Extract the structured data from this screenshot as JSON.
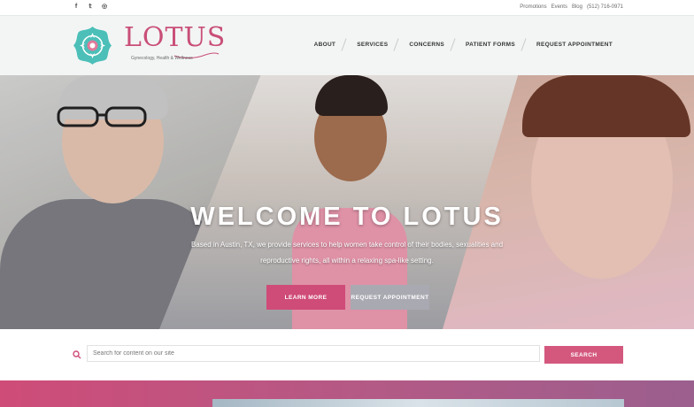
{
  "topbar": {
    "social": [
      {
        "name": "facebook-icon",
        "glyph": "f"
      },
      {
        "name": "twitter-icon",
        "glyph": "𝕥"
      },
      {
        "name": "instagram-icon",
        "glyph": "◎"
      }
    ],
    "links": [
      "Promotions",
      "Events",
      "Blog",
      "(512) 716-0971"
    ]
  },
  "brand": {
    "name": "LOTUS",
    "tagline": "Gynecology, Health & Wellness",
    "logo_color": "#c94f78",
    "mark_color": "#4bbfb8"
  },
  "nav": {
    "items": [
      "ABOUT",
      "SERVICES",
      "CONCERNS",
      "PATIENT FORMS",
      "REQUEST APPOINTMENT"
    ]
  },
  "hero": {
    "title": "WELCOME TO LOTUS",
    "subtitle": "Based in Austin, TX, we provide services to help women take control of their bodies, sexualities and reproductive rights, all within a relaxing spa-like setting.",
    "learn_more": "LEARN MORE",
    "request": "REQUEST APPOINTMENT"
  },
  "search": {
    "placeholder": "Search for content on our site",
    "button": "SEARCH"
  },
  "colors": {
    "accent": "#cf4b78",
    "secondary_button": "#a9a9b2",
    "teal": "#4bbfb8"
  }
}
